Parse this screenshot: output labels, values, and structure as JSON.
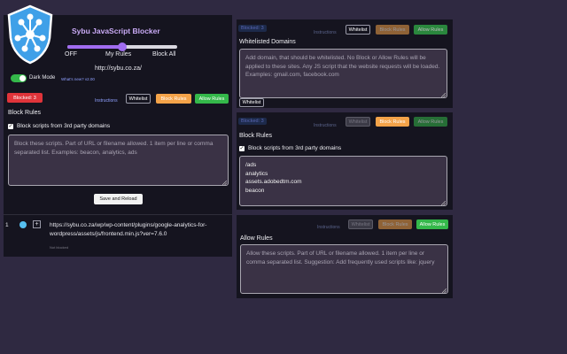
{
  "left": {
    "app_title": "Sybu JavaScript Blocker",
    "modes": [
      "OFF",
      "My Rules",
      "Block All"
    ],
    "mode_level": 0.5,
    "url": "http://sybu.co.za/",
    "dark_mode_label": "Dark Mode",
    "whats_new": "What's new? v2.00",
    "blocked_label": "Blocked: 3",
    "instructions": "Instructions",
    "whitelist": "Whitelist",
    "block_rules_btn": "Block Rules",
    "allow_rules_btn": "Allow Rules",
    "section_title": "Block Rules",
    "checkbox_label": "Block scripts from 3rd party domains",
    "textarea_placeholder": "Block these scripts. Part of URL or filename allowed. 1 item per line or comma separated list. Examples: beacon, analytics, ads",
    "save_button": "Save and Reload",
    "script_item": {
      "index": "1",
      "add": "+",
      "url": "https://sybu.co.za/wp/wp-content/plugins/google-analytics-for-wordpress/assets/js/frontend.min.js?ver=7.6.0",
      "status": "Not blocked"
    }
  },
  "right1": {
    "blocked_label": "Blocked: 3",
    "instructions": "Instructions",
    "whitelist": "Whitelist",
    "block_rules_btn": "Block Rules",
    "allow_rules_btn": "Allow Rules",
    "section_title": "Whitelisted Domains",
    "textarea_placeholder": "Add domain, that should be whitelisted. No Block or Allow Rules will be applied to these sites. Any JS script that the website requests will be loaded. Examples: gmail.com, facebook.com",
    "save_button": "Whitelist"
  },
  "right2": {
    "blocked_label": "Blocked: 3",
    "instructions": "Instructions",
    "whitelist": "Whitelist",
    "block_rules_btn": "Block Rules",
    "allow_rules_btn": "Allow Rules",
    "section_title": "Block Rules",
    "checkbox_label": "Block scripts from 3rd party domains",
    "rules": [
      "/ads",
      "analytics",
      "assets.adobedtm.com",
      "beacon"
    ]
  },
  "right3": {
    "instructions": "Instructions",
    "whitelist": "Whitelist",
    "block_rules_btn": "Block Rules",
    "allow_rules_btn": "Allow Rules",
    "section_title": "Allow Rules",
    "textarea_placeholder": "Allow these scripts. Part of URL or filename allowed. 1 item per line or comma separated list. Suggestion: Add frequently used scripts like: jquery"
  },
  "colors": {
    "background": "#2f2941",
    "panel": "#15141f",
    "accent_purple": "#a06cf0",
    "blocked_red": "#e0343a",
    "block_orange": "#f4a349",
    "allow_green": "#34b84a",
    "shield_blue": "#3fa0e8"
  },
  "icons": [
    "shield-network-icon",
    "plus-icon",
    "check-icon",
    "resize-grip-icon",
    "status-dot-icon"
  ]
}
